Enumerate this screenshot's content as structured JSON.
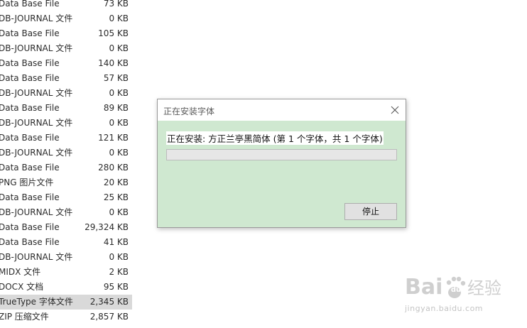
{
  "explorer": {
    "files": [
      {
        "type": "Data Base File",
        "size": "73 KB",
        "selected": false
      },
      {
        "type": "DB-JOURNAL 文件",
        "size": "0 KB",
        "selected": false
      },
      {
        "type": "Data Base File",
        "size": "105 KB",
        "selected": false
      },
      {
        "type": "DB-JOURNAL 文件",
        "size": "0 KB",
        "selected": false
      },
      {
        "type": "Data Base File",
        "size": "140 KB",
        "selected": false
      },
      {
        "type": "Data Base File",
        "size": "57 KB",
        "selected": false
      },
      {
        "type": "DB-JOURNAL 文件",
        "size": "0 KB",
        "selected": false
      },
      {
        "type": "Data Base File",
        "size": "89 KB",
        "selected": false
      },
      {
        "type": "DB-JOURNAL 文件",
        "size": "0 KB",
        "selected": false
      },
      {
        "type": "Data Base File",
        "size": "121 KB",
        "selected": false
      },
      {
        "type": "DB-JOURNAL 文件",
        "size": "0 KB",
        "selected": false
      },
      {
        "type": "Data Base File",
        "size": "280 KB",
        "selected": false
      },
      {
        "type": "PNG 图片文件",
        "size": "20 KB",
        "selected": false
      },
      {
        "type": "Data Base File",
        "size": "25 KB",
        "selected": false
      },
      {
        "type": "DB-JOURNAL 文件",
        "size": "0 KB",
        "selected": false
      },
      {
        "type": "Data Base File",
        "size": "29,324 KB",
        "selected": false
      },
      {
        "type": "Data Base File",
        "size": "41 KB",
        "selected": false
      },
      {
        "type": "DB-JOURNAL 文件",
        "size": "0 KB",
        "selected": false
      },
      {
        "type": "MIDX 文件",
        "size": "2 KB",
        "selected": false
      },
      {
        "type": "DOCX 文档",
        "size": "95 KB",
        "selected": false
      },
      {
        "type": "TrueType 字体文件",
        "size": "2,345 KB",
        "selected": true
      },
      {
        "type": "ZIP 压缩文件",
        "size": "2,857 KB",
        "selected": false
      }
    ]
  },
  "dialog": {
    "title": "正在安装字体",
    "status": "正在安装: 方正兰亭黑简体 (第 1 个字体，共 1 个字体)",
    "progress": 0,
    "stop_label": "停止",
    "close_icon": "close-icon",
    "background_color": "#cfe8d0"
  },
  "watermark": {
    "brand": "Baidu 经验",
    "url": "jingyan.baidu.com"
  }
}
